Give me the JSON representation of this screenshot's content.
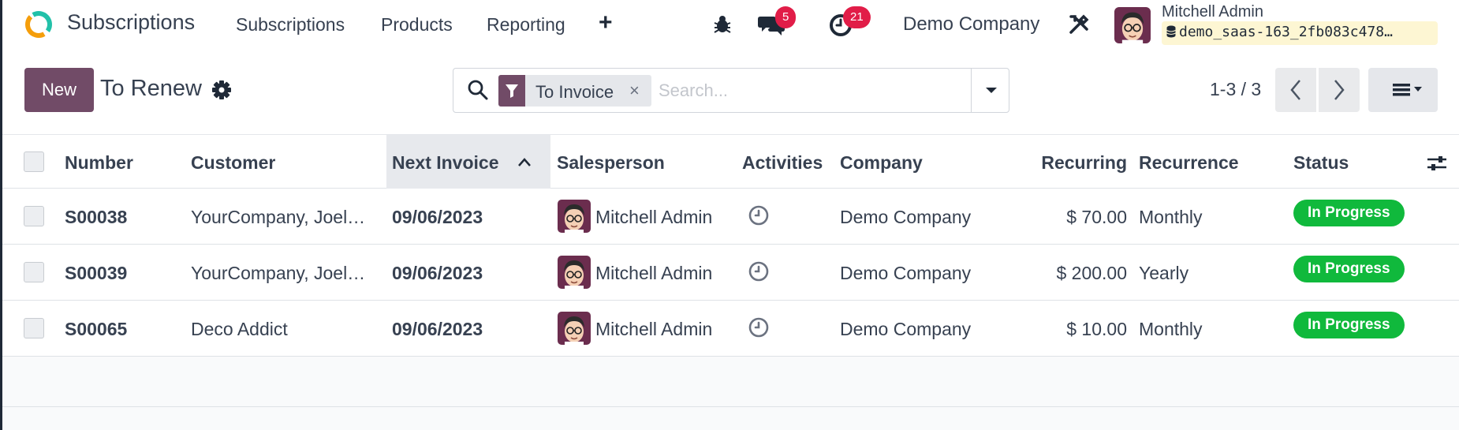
{
  "app": {
    "name": "Subscriptions",
    "brand_color": "#714b67"
  },
  "nav": {
    "items": [
      {
        "label": "Subscriptions"
      },
      {
        "label": "Products"
      },
      {
        "label": "Reporting"
      }
    ],
    "plus_icon": "plus-icon"
  },
  "systray": {
    "debug_icon": "bug-icon",
    "messages": {
      "icon": "chat-icon",
      "count": "5"
    },
    "activities": {
      "icon": "clock-icon",
      "count": "21"
    },
    "company": "Demo Company",
    "tools_icon": "wrench-screwdriver-icon",
    "user": {
      "name": "Mitchell Admin",
      "database": "demo_saas-163_2fb083c478…"
    }
  },
  "control_panel": {
    "new_label": "New",
    "view_title": "To Renew",
    "search": {
      "facet": "To Invoice",
      "placeholder": "Search..."
    },
    "pager": "1-3 / 3"
  },
  "table": {
    "columns": [
      "Number",
      "Customer",
      "Next Invoice",
      "Salesperson",
      "Activities",
      "Company",
      "Recurring",
      "Recurrence",
      "Status"
    ],
    "rows": [
      {
        "number": "S00038",
        "customer": "YourCompany, Joel…",
        "next_invoice": "09/06/2023",
        "salesperson": "Mitchell Admin",
        "company": "Demo Company",
        "recurring": "$ 70.00",
        "recurrence": "Monthly",
        "status": "In Progress"
      },
      {
        "number": "S00039",
        "customer": "YourCompany, Joel…",
        "next_invoice": "09/06/2023",
        "salesperson": "Mitchell Admin",
        "company": "Demo Company",
        "recurring": "$ 200.00",
        "recurrence": "Yearly",
        "status": "In Progress"
      },
      {
        "number": "S00065",
        "customer": "Deco Addict",
        "next_invoice": "09/06/2023",
        "salesperson": "Mitchell Admin",
        "company": "Demo Company",
        "recurring": "$ 10.00",
        "recurrence": "Monthly",
        "status": "In Progress"
      }
    ],
    "status_color": "#10b93c"
  }
}
